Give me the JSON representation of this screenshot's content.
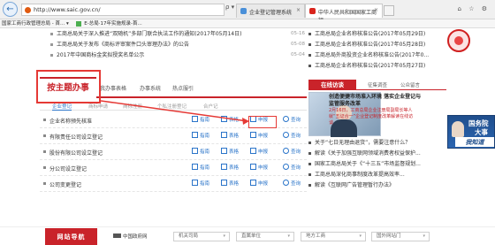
{
  "browser": {
    "url": "http://www.saic.gov.cn/",
    "url_tools": "ρ ▾ C",
    "tabs": [
      {
        "label": "企业登记管理系统",
        "close": "×"
      },
      {
        "label": "中华人民共和国国家工商行...",
        "close": "×"
      }
    ],
    "window_icons": "⌂ ☆ ⚙",
    "toolbar_text": "国家工商行政管理总局 - 首... ▾",
    "toolbar_item2": "E-总局·17年实施规录-首..."
  },
  "news_left": [
    {
      "text": "工商总局关于深入推进“双随机”多部门联合执法工作的通知(2017年05月14日)",
      "date": "05-16"
    },
    {
      "text": "工商总局关于发布《商标评审案件口头审理办法》的公告",
      "date": "05-08"
    },
    {
      "text": "2017年中国商标金奖拟授奖名单公示",
      "date": "05-04"
    }
  ],
  "news_right": [
    "工商总局企业名称核准公告(2017年05月29日)",
    "工商总局企业名称核准公告(2017年05月28日)",
    "工商总局外商投资企业名称核准公告(2017年0...",
    "工商总局企业名称核准公告(2017年05月27日)"
  ],
  "panel": {
    "main_tab": "按主题办事",
    "tabs": [
      "我办事表格",
      "办事系统",
      "热点服引"
    ],
    "subtabs": [
      "企业登记",
      "商标申请",
      "商标注册",
      "个私注册登记",
      "合户记"
    ],
    "rows": [
      {
        "label": "企业名称预先核准"
      },
      {
        "label": "有限责任公司设立登记"
      },
      {
        "label": "股份有限公司设立登记"
      },
      {
        "label": "分公司设立登记"
      },
      {
        "label": "公司变更登记"
      }
    ],
    "actions": {
      "guide": "指南",
      "form": "表格",
      "apply": "申报",
      "query": "查询"
    }
  },
  "talk": {
    "title": "在线访谈",
    "tab1": "征集调查",
    "tab2": "公众留言",
    "headline": "创造便捷市场准入环境 落实企业登记与监管服务改革",
    "sub": "2月16日，工商总局企业注册局副局长等人就“五证合一”企业登记制度改革解读在线访谈"
  },
  "news_right2": [
    "关于“七日无理由退货”，需要注意什么？",
    "解读《关于加强互联网领域消费者权益保护...",
    "国家工商总局关于《“十三五”市场监督规划...",
    "工商总局深化商事制度改革提高效率...",
    "解读《互联网广告管理暂行办法》"
  ],
  "gov_banner": {
    "line1": "国务院",
    "line2": "大事",
    "line3": "我知道"
  },
  "bottom_nav": {
    "title": "网站导航",
    "gov_link": "中国政府网",
    "selects": [
      {
        "label": "机关司局"
      },
      {
        "label": "直属单位"
      },
      {
        "label": "地方工商"
      },
      {
        "label": "国外网站门"
      }
    ],
    "arrow": "▾"
  },
  "colors": {
    "brand_red": "#c9232a",
    "link_blue": "#2a74c9",
    "annotation_red": "#e53935"
  },
  "icons": [
    "back-arrow-icon",
    "document-icon",
    "table-icon",
    "edit-icon",
    "search-icon",
    "globe-icon"
  ]
}
